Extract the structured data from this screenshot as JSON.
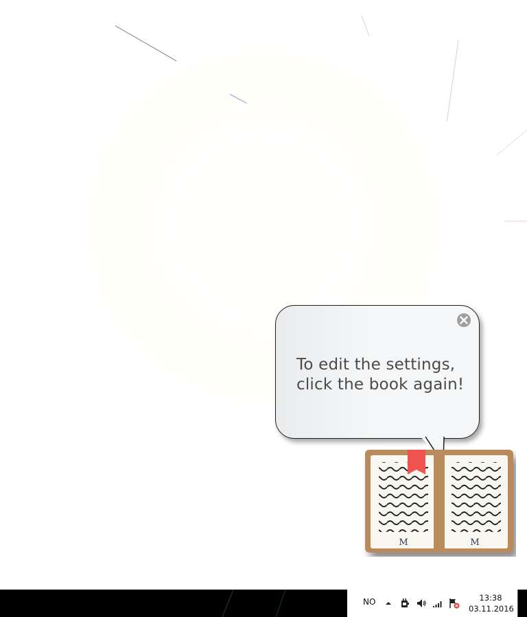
{
  "tooltip": {
    "line1": "To edit the settings,",
    "line2": "click the book again!",
    "close_icon": "close-icon"
  },
  "book": {
    "icon": "open-book-icon",
    "left_page_letter": "M",
    "right_page_letter": "M",
    "bookmark_color": "#ef5350",
    "cover_color": "#b98b5b"
  },
  "taskbar": {
    "language": "NO",
    "tray_icons": [
      "chevron-up-icon",
      "power-plug-icon",
      "speaker-icon",
      "signal-bars-icon",
      "action-center-flag-icon"
    ],
    "time": "13:38",
    "date": "03.11.2016"
  }
}
